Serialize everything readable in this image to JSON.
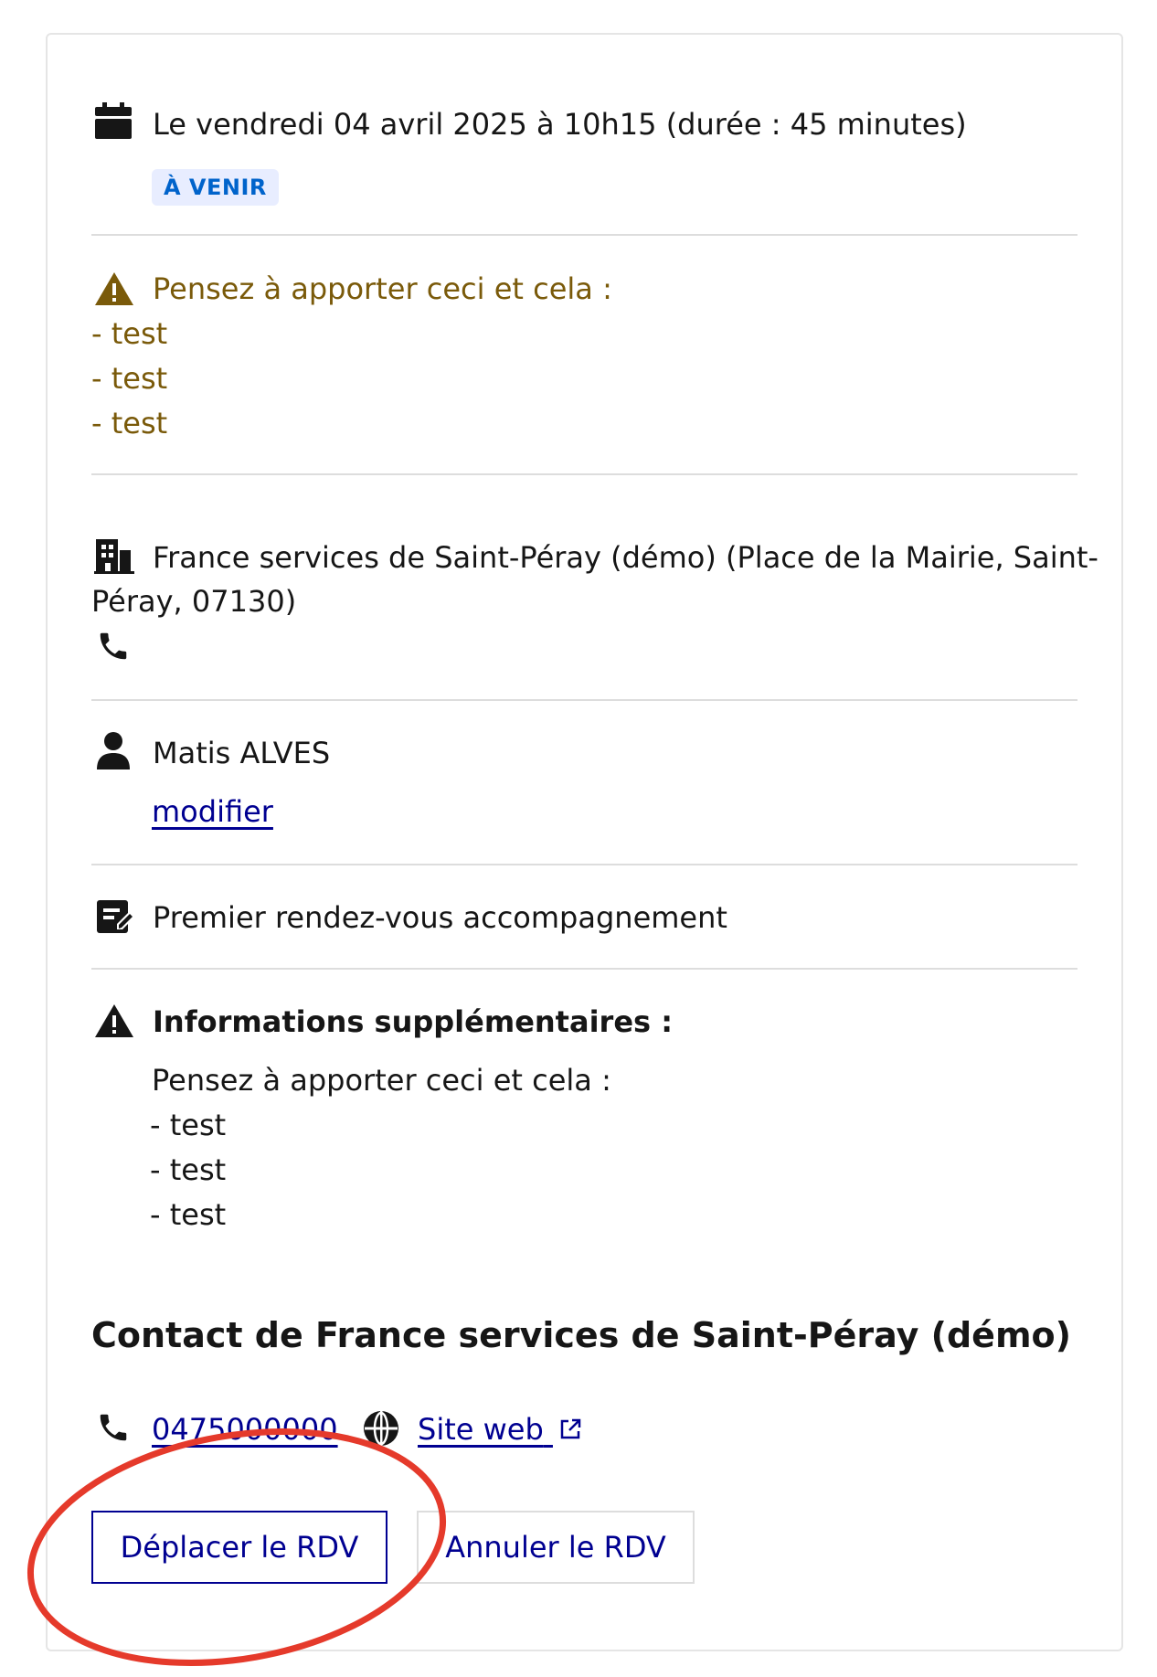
{
  "appointment": {
    "date_text": "Le vendredi 04 avril 2025 à 10h15 (durée : 45 minutes)",
    "status_badge": "À VENIR",
    "warning_title": "Pensez à apporter ceci et cela :",
    "warning_items": [
      "- test",
      "- test",
      "- test"
    ],
    "location_line1": "France services de Saint-Péray (démo) (Place de la Mairie, Saint-",
    "location_line2": "Péray, 07130)",
    "person_name": "Matis ALVES",
    "modify_link": "modifier",
    "motif": "Premier rendez-vous accompagnement",
    "info_title": "Informations supplémentaires :",
    "info_text": "Pensez à apporter ceci et cela :",
    "info_items": [
      "- test",
      "- test",
      "- test"
    ]
  },
  "contact": {
    "heading": "Contact de France services de Saint-Péray (démo)",
    "phone": "0475000000",
    "website_label": "Site web"
  },
  "actions": {
    "move_label": "Déplacer le RDV",
    "cancel_label": "Annuler le RDV"
  },
  "colors": {
    "primary": "#000091",
    "badge_bg": "#e8edff",
    "badge_text": "#0063cb",
    "warning_text": "#7a5a0a",
    "annotation": "#e53a2b"
  },
  "icons": [
    "calendar-icon",
    "warning-icon",
    "building-icon",
    "phone-icon",
    "user-icon",
    "edit-note-icon",
    "globe-icon",
    "external-link-icon"
  ]
}
